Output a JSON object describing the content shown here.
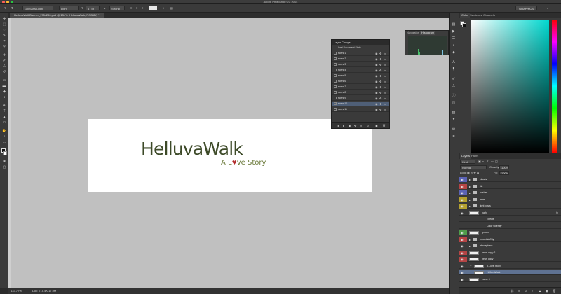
{
  "app": {
    "title": "Adobe Photoshop CC 2014"
  },
  "options": {
    "font_family": "Gill Sans Light",
    "font_style": "Light",
    "font_size": "47 pt",
    "aa_mode": "Strong",
    "workspace": "GRAPHICS"
  },
  "document": {
    "tab": "HelluvaWalkBanner_975x250.psd @ 134% (HelluvaWalk, RGB/8#) *",
    "zoom": "133.72%",
    "doc_size": "Doc: 715.4K/17.9M",
    "brand_title": "HelluvaWalk",
    "tagline_before": "A L",
    "tagline_heart": "♥",
    "tagline_after": "ve Story"
  },
  "navigator": {
    "tabs": [
      "Navigator",
      "Histogram"
    ]
  },
  "layer_comps": {
    "title": "Layer Comps",
    "last_state": "Last Document State",
    "comps": [
      "scene1",
      "scene2",
      "scene3",
      "scene4",
      "scene5",
      "scene6",
      "scene7",
      "scene8",
      "scene9",
      "scene10",
      "scene11"
    ],
    "selected_index": 9
  },
  "color_panel": {
    "tabs": [
      "Color",
      "Swatches",
      "Channels"
    ]
  },
  "layers_panel": {
    "tabs": [
      "Layers",
      "Paths"
    ],
    "filter": "Kind",
    "blend_mode": "Normal",
    "opacity_label": "Opacity:",
    "opacity": "100%",
    "lock_label": "Lock:",
    "fill_label": "Fill:",
    "fill": "100%",
    "layers": [
      {
        "name": "clouds",
        "type": "group",
        "color": "#5b63b5"
      },
      {
        "name": "tile",
        "type": "group",
        "color": "#b54444"
      },
      {
        "name": "bushes",
        "type": "group",
        "color": "#5b63b5"
      },
      {
        "name": "trees",
        "type": "group",
        "color": "#b5a12f"
      },
      {
        "name": "light posts",
        "type": "group",
        "color": "#b5a12f"
      },
      {
        "name": "path",
        "type": "layer",
        "color": "",
        "fx": "fx"
      },
      {
        "name": "Effects",
        "type": "effect",
        "color": ""
      },
      {
        "name": "Color Overlay",
        "type": "effect",
        "color": ""
      },
      {
        "name": "ground",
        "type": "layer",
        "color": "#4f9c4a"
      },
      {
        "name": "mountainCity",
        "type": "group",
        "color": "#b54444"
      },
      {
        "name": "atmosphere",
        "type": "group",
        "color": ""
      },
      {
        "name": "heart copy 2",
        "type": "layer",
        "color": "#b54444"
      },
      {
        "name": "heart copy",
        "type": "layer",
        "color": "#b54444"
      },
      {
        "name": "A Love Story",
        "type": "text",
        "color": ""
      },
      {
        "name": "HelluvaWalk",
        "type": "text",
        "color": ""
      },
      {
        "name": "Layer 0",
        "type": "layer",
        "color": ""
      }
    ],
    "selected_index": 14
  }
}
